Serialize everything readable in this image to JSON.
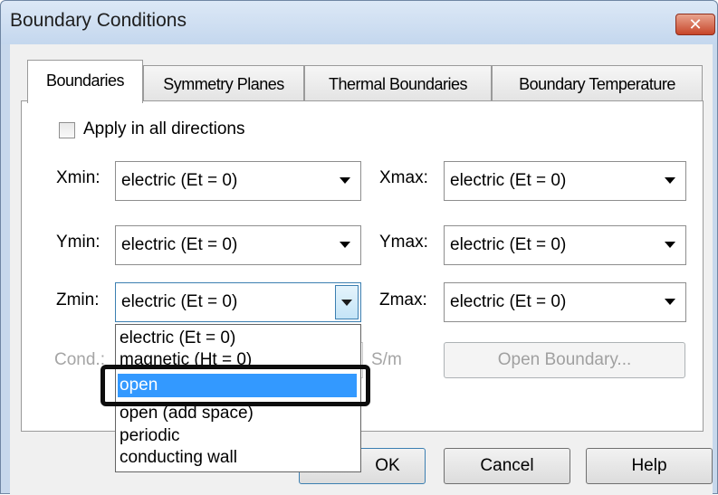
{
  "window": {
    "title": "Boundary Conditions",
    "close_label": "✕"
  },
  "tabs": [
    {
      "label": "Boundaries",
      "active": true
    },
    {
      "label": "Symmetry Planes",
      "active": false
    },
    {
      "label": "Thermal Boundaries",
      "active": false
    },
    {
      "label": "Boundary Temperature",
      "active": false
    }
  ],
  "apply_all": {
    "label": "Apply in all directions",
    "checked": false
  },
  "fields": {
    "xmin": {
      "label": "Xmin:",
      "value": "electric (Et = 0)"
    },
    "xmax": {
      "label": "Xmax:",
      "value": "electric (Et = 0)"
    },
    "ymin": {
      "label": "Ymin:",
      "value": "electric (Et = 0)"
    },
    "ymax": {
      "label": "Ymax:",
      "value": "electric (Et = 0)"
    },
    "zmin": {
      "label": "Zmin:",
      "value": "electric (Et = 0)"
    },
    "zmax": {
      "label": "Zmax:",
      "value": "electric (Et = 0)"
    }
  },
  "cond": {
    "label": "Cond.:",
    "unit": "S/m"
  },
  "open_boundary_label": "Open Boundary...",
  "dropdown": {
    "options": [
      "electric (Et = 0)",
      "magnetic (Ht = 0)",
      "open",
      "open (add space)",
      "periodic",
      "conducting wall"
    ],
    "selected": "open"
  },
  "buttons": {
    "ok": "OK",
    "cancel": "Cancel",
    "help": "Help"
  }
}
